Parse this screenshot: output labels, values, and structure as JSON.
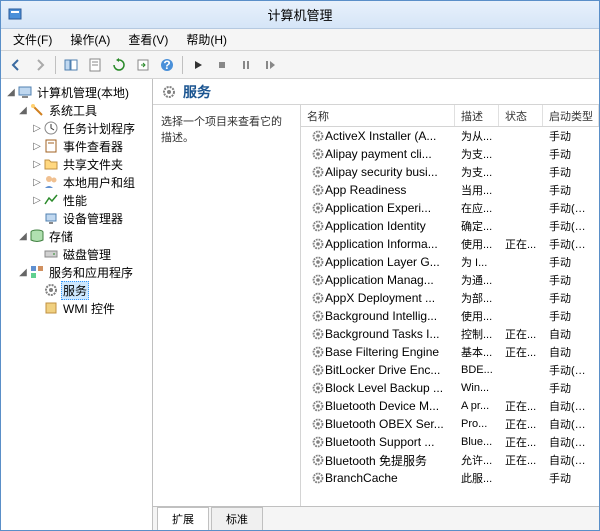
{
  "window": {
    "title": "计算机管理"
  },
  "menu": {
    "file": "文件(F)",
    "action": "操作(A)",
    "view": "查看(V)",
    "help": "帮助(H)"
  },
  "tree": {
    "root": "计算机管理(本地)",
    "n1": "系统工具",
    "n1_1": "任务计划程序",
    "n1_2": "事件查看器",
    "n1_3": "共享文件夹",
    "n1_4": "本地用户和组",
    "n1_5": "性能",
    "n1_6": "设备管理器",
    "n2": "存储",
    "n2_1": "磁盘管理",
    "n3": "服务和应用程序",
    "n3_1": "服务",
    "n3_2": "WMI 控件"
  },
  "content": {
    "title": "服务",
    "description": "选择一个项目来查看它的描述。",
    "columns": {
      "name": "名称",
      "desc": "描述",
      "status": "状态",
      "startup": "启动类型"
    },
    "rows": [
      {
        "name": "ActiveX Installer (A...",
        "desc": "为从...",
        "status": "",
        "startup": "手动"
      },
      {
        "name": "Alipay payment cli...",
        "desc": "为支...",
        "status": "",
        "startup": "手动"
      },
      {
        "name": "Alipay security busi...",
        "desc": "为支...",
        "status": "",
        "startup": "手动"
      },
      {
        "name": "App Readiness",
        "desc": "当用...",
        "status": "",
        "startup": "手动"
      },
      {
        "name": "Application Experi...",
        "desc": "在应...",
        "status": "",
        "startup": "手动(触..."
      },
      {
        "name": "Application Identity",
        "desc": "确定...",
        "status": "",
        "startup": "手动(触..."
      },
      {
        "name": "Application Informa...",
        "desc": "使用...",
        "status": "正在...",
        "startup": "手动(触..."
      },
      {
        "name": "Application Layer G...",
        "desc": "为 I...",
        "status": "",
        "startup": "手动"
      },
      {
        "name": "Application Manag...",
        "desc": "为通...",
        "status": "",
        "startup": "手动"
      },
      {
        "name": "AppX Deployment ...",
        "desc": "为部...",
        "status": "",
        "startup": "手动"
      },
      {
        "name": "Background Intellig...",
        "desc": "使用...",
        "status": "",
        "startup": "手动"
      },
      {
        "name": "Background Tasks I...",
        "desc": "控制...",
        "status": "正在...",
        "startup": "自动"
      },
      {
        "name": "Base Filtering Engine",
        "desc": "基本...",
        "status": "正在...",
        "startup": "自动"
      },
      {
        "name": "BitLocker Drive Enc...",
        "desc": "BDE...",
        "status": "",
        "startup": "手动(触..."
      },
      {
        "name": "Block Level Backup ...",
        "desc": "Win...",
        "status": "",
        "startup": "手动"
      },
      {
        "name": "Bluetooth Device M...",
        "desc": "A pr...",
        "status": "正在...",
        "startup": "自动(延..."
      },
      {
        "name": "Bluetooth OBEX Ser...",
        "desc": "Pro...",
        "status": "正在...",
        "startup": "自动(延..."
      },
      {
        "name": "Bluetooth Support ...",
        "desc": "Blue...",
        "status": "正在...",
        "startup": "自动(触..."
      },
      {
        "name": "Bluetooth 免提服务",
        "desc": "允许...",
        "status": "正在...",
        "startup": "自动(触..."
      },
      {
        "name": "BranchCache",
        "desc": "此服...",
        "status": "",
        "startup": "手动"
      }
    ]
  },
  "tabs": {
    "extended": "扩展",
    "standard": "标准"
  }
}
